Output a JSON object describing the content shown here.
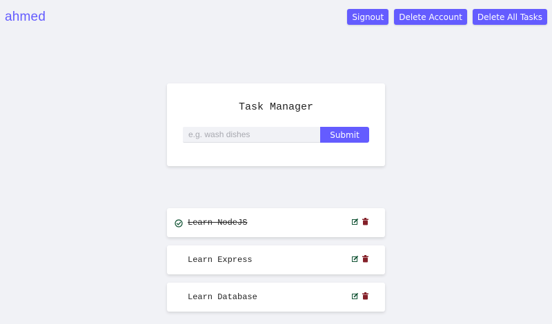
{
  "brand": "ahmed",
  "header": {
    "signout_label": "Signout",
    "delete_account_label": "Delete Account",
    "delete_all_label": "Delete All Tasks"
  },
  "form": {
    "title": "Task Manager",
    "placeholder": "e.g. wash dishes",
    "value": "",
    "submit_label": "Submit"
  },
  "tasks": [
    {
      "name": "Learn NodeJS",
      "completed": true
    },
    {
      "name": "Learn Express",
      "completed": false
    },
    {
      "name": "Learn Database",
      "completed": false
    }
  ],
  "icons": {
    "completed": "check-circle-icon",
    "edit": "edit-icon",
    "delete": "trash-icon"
  },
  "colors": {
    "accent": "#645cff",
    "background": "#f1f2f6",
    "check": "#0f5132",
    "edit": "#0f5132",
    "delete": "#842029"
  }
}
